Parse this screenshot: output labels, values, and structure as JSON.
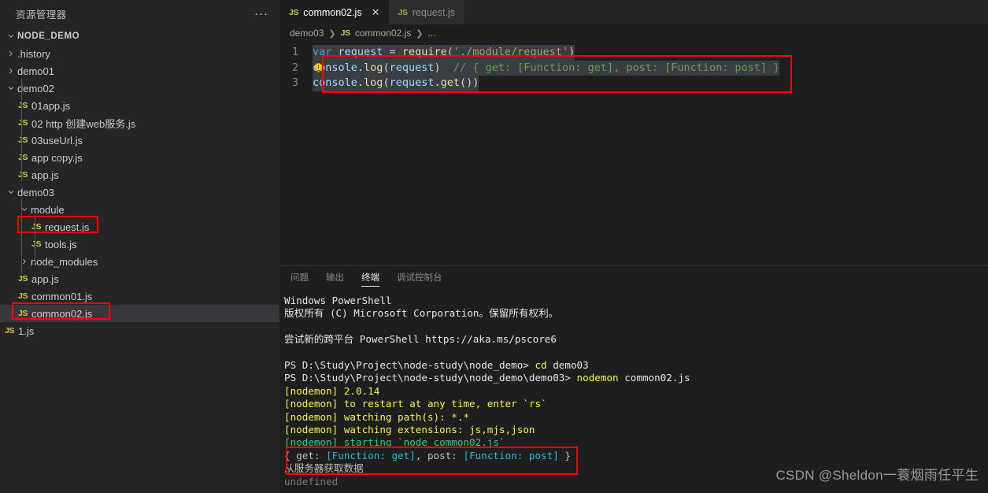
{
  "sidebar": {
    "header_title": "资源管理器",
    "more_actions": "···",
    "root": "NODE_DEMO",
    "items": [
      {
        "label": ".history",
        "type": "folder",
        "state": "collapsed",
        "depth": 1
      },
      {
        "label": "demo01",
        "type": "folder",
        "state": "collapsed",
        "depth": 1
      },
      {
        "label": "demo02",
        "type": "folder",
        "state": "expanded",
        "depth": 1
      },
      {
        "label": "01app.js",
        "type": "file",
        "depth": 2
      },
      {
        "label": "02 http 创建web服务.js",
        "type": "file",
        "depth": 2
      },
      {
        "label": "03useUrl.js",
        "type": "file",
        "depth": 2
      },
      {
        "label": "app copy.js",
        "type": "file",
        "depth": 2
      },
      {
        "label": "app.js",
        "type": "file",
        "depth": 2
      },
      {
        "label": "demo03",
        "type": "folder",
        "state": "expanded",
        "depth": 1
      },
      {
        "label": "module",
        "type": "folder",
        "state": "expanded",
        "depth": 2
      },
      {
        "label": "request.js",
        "type": "file",
        "depth": 3,
        "highlighted": true
      },
      {
        "label": "tools.js",
        "type": "file",
        "depth": 3
      },
      {
        "label": "node_modules",
        "type": "folder",
        "state": "collapsed",
        "depth": 2
      },
      {
        "label": "app.js",
        "type": "file",
        "depth": 2
      },
      {
        "label": "common01.js",
        "type": "file",
        "depth": 2
      },
      {
        "label": "common02.js",
        "type": "file",
        "depth": 2,
        "highlighted": true,
        "selected": true
      },
      {
        "label": "1.js",
        "type": "file",
        "depth": 1
      }
    ],
    "file_badge": "JS"
  },
  "tabs": [
    {
      "label": "common02.js",
      "badge": "JS",
      "active": true,
      "close": "✕"
    },
    {
      "label": "request.js",
      "badge": "JS",
      "active": false
    }
  ],
  "breadcrumb": {
    "part1": "demo03",
    "badge": "JS",
    "part2": "common02.js",
    "part3": "...",
    "separator": "❯"
  },
  "editor": {
    "lines": [
      {
        "number": "1",
        "tokens": [
          {
            "text": "var ",
            "cls": "k-kw"
          },
          {
            "text": "request",
            "cls": "k-var"
          },
          {
            "text": " = ",
            "cls": "k-punc"
          },
          {
            "text": "require",
            "cls": "k-fn"
          },
          {
            "text": "(",
            "cls": "k-punc"
          },
          {
            "text": "'./module/request'",
            "cls": "k-str"
          },
          {
            "text": ")",
            "cls": "k-punc"
          }
        ]
      },
      {
        "number": "2",
        "bulb": "lightbulb-icon",
        "tokens": [
          {
            "text": "console",
            "cls": "k-var"
          },
          {
            "text": ".",
            "cls": "k-punc"
          },
          {
            "text": "log",
            "cls": "k-fn"
          },
          {
            "text": "(",
            "cls": "k-punc"
          },
          {
            "text": "request",
            "cls": "k-var"
          },
          {
            "text": ")",
            "cls": "k-punc"
          },
          {
            "text": "  // { get: [Function: get], post: [Function: post] }",
            "cls": "k-com"
          }
        ]
      },
      {
        "number": "3",
        "tokens": [
          {
            "text": "console",
            "cls": "k-var"
          },
          {
            "text": ".",
            "cls": "k-punc"
          },
          {
            "text": "log",
            "cls": "k-fn"
          },
          {
            "text": "(",
            "cls": "k-punc"
          },
          {
            "text": "request",
            "cls": "k-var"
          },
          {
            "text": ".",
            "cls": "k-punc"
          },
          {
            "text": "get",
            "cls": "k-fn"
          },
          {
            "text": "())",
            "cls": "k-punc"
          }
        ]
      }
    ]
  },
  "panel": {
    "tabs": [
      {
        "label": "问题",
        "active": false
      },
      {
        "label": "输出",
        "active": false
      },
      {
        "label": "终端",
        "active": true
      },
      {
        "label": "调试控制台",
        "active": false
      }
    ],
    "terminal_lines": [
      [
        {
          "text": "Windows PowerShell",
          "cls": "t-white"
        }
      ],
      [
        {
          "text": "版权所有 (C) Microsoft Corporation。保留所有权利。",
          "cls": "t-white"
        }
      ],
      [
        {
          "text": "",
          "cls": "t-white"
        }
      ],
      [
        {
          "text": "尝试新的跨平台 PowerShell https://aka.ms/pscore6",
          "cls": "t-white"
        }
      ],
      [
        {
          "text": "",
          "cls": "t-white"
        }
      ],
      [
        {
          "text": "PS D:\\Study\\Project\\node-study\\node_demo> ",
          "cls": "t-white"
        },
        {
          "text": "cd",
          "cls": "t-yellow"
        },
        {
          "text": " demo03",
          "cls": "t-white"
        }
      ],
      [
        {
          "text": "PS D:\\Study\\Project\\node-study\\node_demo\\demo03> ",
          "cls": "t-white"
        },
        {
          "text": "nodemon",
          "cls": "t-yellow"
        },
        {
          "text": " common02.js",
          "cls": "t-white"
        }
      ],
      [
        {
          "text": "[nodemon] 2.0.14",
          "cls": "t-yellow"
        }
      ],
      [
        {
          "text": "[nodemon] to restart at any time, enter `rs`",
          "cls": "t-yellow"
        }
      ],
      [
        {
          "text": "[nodemon] watching path(s): *.*",
          "cls": "t-yellow"
        }
      ],
      [
        {
          "text": "[nodemon] watching extensions: js,mjs,json",
          "cls": "t-yellow"
        }
      ],
      [
        {
          "text": "[nodemon] starting `node common02.js`",
          "cls": "t-green"
        }
      ],
      [
        {
          "text": "{ get: ",
          "cls": "t-dim"
        },
        {
          "text": "[Function: get]",
          "cls": "t-cyan"
        },
        {
          "text": ", post: ",
          "cls": "t-dim"
        },
        {
          "text": "[Function: post]",
          "cls": "t-cyan"
        },
        {
          "text": " }",
          "cls": "t-dim"
        }
      ],
      [
        {
          "text": "从服务器获取数据",
          "cls": "t-dim"
        }
      ],
      [
        {
          "text": "undefined",
          "cls": "t-gray"
        }
      ]
    ]
  },
  "watermark": "CSDN @Sheldon一蓑烟雨任平生",
  "colors": {
    "annotation_red": "#ff0000",
    "sidebar_bg": "#252526",
    "editor_bg": "#1e1e1e",
    "selected_row": "#37373d",
    "js_badge": "#cbcb41"
  }
}
